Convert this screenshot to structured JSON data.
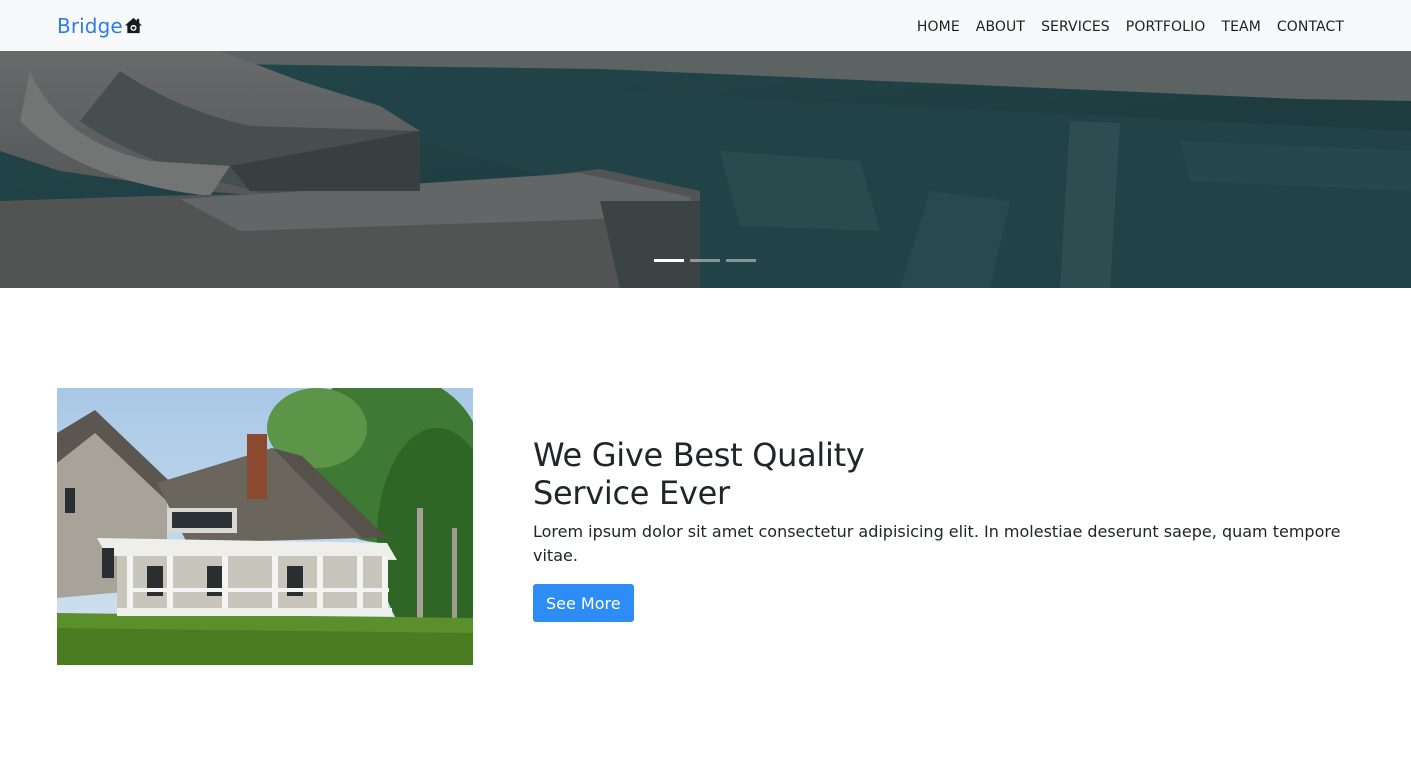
{
  "brand": {
    "name": "Bridge",
    "icon": "home-icon",
    "color": "#2f7de1"
  },
  "nav": {
    "items": [
      {
        "label": "HOME"
      },
      {
        "label": "ABOUT"
      },
      {
        "label": "SERVICES"
      },
      {
        "label": "PORTFOLIO"
      },
      {
        "label": "TEAM"
      },
      {
        "label": "CONTACT"
      }
    ]
  },
  "hero": {
    "image": "pool-photo",
    "slides": 3,
    "active_slide": 1
  },
  "about": {
    "image": "house-photo",
    "title_line1": "We Give Best Quality",
    "title_line2": "Service Ever",
    "description": "Lorem ipsum dolor sit amet consectetur adipisicing elit. In molestiae deserunt saepe, quam tempore vitae.",
    "button_label": "See More",
    "button_color": "#2d8cf5"
  }
}
